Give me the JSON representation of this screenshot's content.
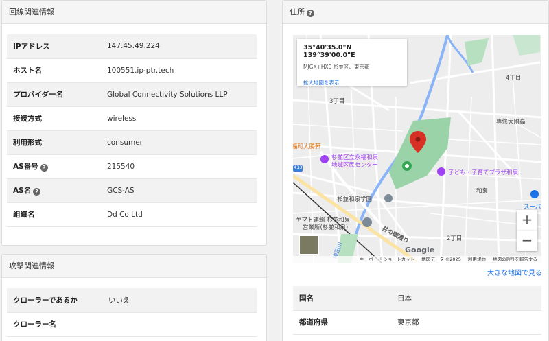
{
  "network_panel": {
    "title": "回線関連情報",
    "rows": [
      {
        "label": "IPアドレス",
        "value": "147.45.49.224"
      },
      {
        "label": "ホスト名",
        "value": "100551.ip-ptr.tech"
      },
      {
        "label": "プロバイダー名",
        "value": "Global Connectivity Solutions LLP"
      },
      {
        "label": "接続方式",
        "value": "wireless"
      },
      {
        "label": "利用形式",
        "value": "consumer"
      },
      {
        "label": "AS番号",
        "value": "215540",
        "help_icon": "question-circle-icon"
      },
      {
        "label": "AS名",
        "value": "GCS-AS",
        "help_icon": "question-circle-icon"
      },
      {
        "label": "組織名",
        "value": "Dd Co Ltd"
      }
    ]
  },
  "attack_panel": {
    "title": "攻撃関連情報",
    "rows": [
      {
        "label": "クローラーであるか",
        "value": "いいえ"
      },
      {
        "label": "クローラー名",
        "value": ""
      }
    ]
  },
  "address_panel": {
    "title": "住所",
    "help_icon": "question-circle-icon",
    "map": {
      "info_card": {
        "coords": "35°40'35.0\"N 139°39'00.0\"E",
        "plus_code": "MJGX+HX9 杉並区、東京都",
        "link": "拡大地図を表示"
      },
      "labels": {
        "l1": "4丁目",
        "l2": "3丁目",
        "l3": "専修大附高",
        "l4": "福町大勝軒",
        "l5": "杉並区立永福和泉",
        "l5b": "地域区民センター",
        "l6": "子ども・子育てプラザ和泉",
        "l7": "和泉",
        "l8": "杉並和泉学園",
        "l9": "スーパ",
        "l10": "ヤマト運輸 杉並和泉",
        "l10b": "営業所(杉並和泉)",
        "l11": "井の頭通り",
        "l12": "2丁目",
        "l13": "神田川",
        "l14": "413"
      },
      "zoom_in": "+",
      "zoom_out": "−",
      "google": "Google",
      "footer": {
        "shortcuts": "キーボード ショートカット",
        "data": "地図データ ©2025",
        "terms": "利用規約",
        "report": "地図の誤りを報告する"
      }
    },
    "big_map_link": "大きな地図で見る",
    "rows": [
      {
        "label": "国名",
        "value": "日本"
      },
      {
        "label": "都道府県",
        "value": "東京都"
      }
    ]
  },
  "colors": {
    "park": "#9ad3a8",
    "water": "#8ab4f8",
    "marker": "#d93025",
    "poi_purple": "#a142f4",
    "link": "#1a73e8"
  }
}
